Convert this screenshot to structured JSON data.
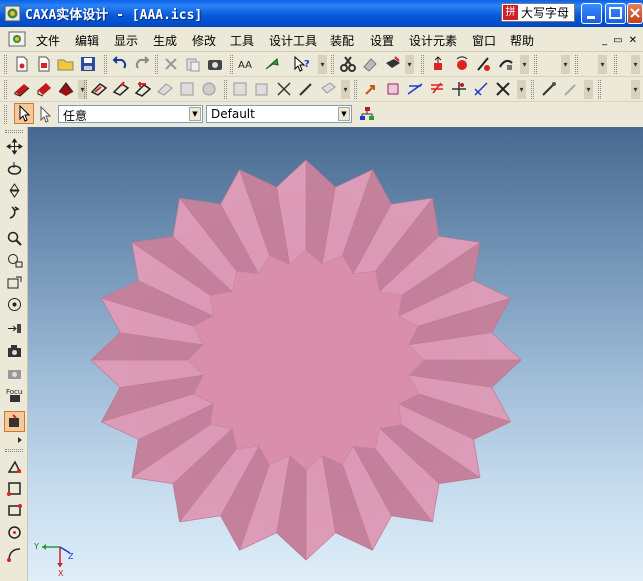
{
  "window": {
    "title": "CAXA实体设计 - [AAA.ics]",
    "ime_label": "大写字母"
  },
  "menu": {
    "items": [
      "文件",
      "编辑",
      "显示",
      "生成",
      "修改",
      "工具",
      "设计工具",
      "装配",
      "设置",
      "设计元素",
      "窗口",
      "帮助"
    ]
  },
  "filter_bar": {
    "pick_filter_value": "任意",
    "scheme_value": "Default"
  },
  "viewport": {
    "axis_labels": {
      "y": "Y",
      "z": "Z",
      "x": "X"
    },
    "part_color": "#d98fac",
    "background_top": "#47698f",
    "background_bottom": "#dfeef9"
  },
  "toolbar1_icons": [
    "new-doc-icon",
    "new-drawing-icon",
    "open-icon",
    "save-icon",
    "undo-icon",
    "redo-icon",
    "copy-icon",
    "paste-icon",
    "camera-icon",
    "find-icon",
    "green-arrow-icon",
    "whats-this-icon",
    "scissors-icon",
    "eraser-icon",
    "sketch-icon",
    "extrude-icon",
    "rotate-icon",
    "loft-icon",
    "sweep-icon"
  ],
  "toolbar2_icons": [
    "box-red-icon",
    "cylinder-red-icon",
    "cone-red-icon",
    "fillet-icon",
    "chamfer-icon",
    "shell-icon",
    "taper-icon",
    "split-icon",
    "sweep-solid-icon",
    "cut-icon",
    "draft-icon",
    "arrow-orange-icon",
    "point-icon",
    "edge-icon",
    "face-icon",
    "axis-icon",
    "measure-icon",
    "pen-icon",
    "wand-icon"
  ],
  "left_toolbar_icons": [
    "move-icon",
    "rotate-view-icon",
    "walk-icon",
    "roll-icon",
    "zoom-icon",
    "zoom-window-icon",
    "pan-icon",
    "orbit-icon",
    "look-at-icon",
    "camera-icon",
    "camera-target-icon",
    "camera-focus-icon",
    "render-icon",
    "sketch-line-icon",
    "rectangle-icon",
    "rect-three-icon",
    "circle-icon",
    "arc-icon"
  ]
}
